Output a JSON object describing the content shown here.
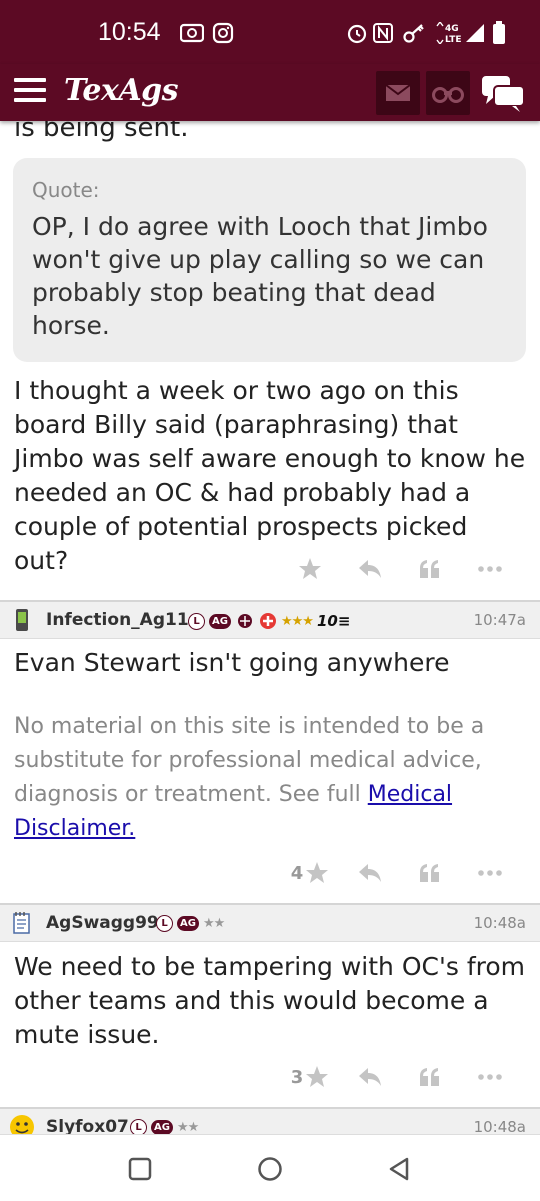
{
  "status_bar": {
    "time": "10:54",
    "network": "4G LTE"
  },
  "app_bar": {
    "logo": "TexAgs"
  },
  "thread": {
    "top_text": "is being sent.",
    "quote_label": "Quote:",
    "quote_text": "OP, I do agree with Looch that Jimbo won't give up play calling so we can probably stop beating that dead horse.",
    "reply_text": "I thought a week or two ago on this board Billy said (paraphrasing) that Jimbo was self aware enough to know he needed an OC & had probably had a couple of potential prospects picked out?"
  },
  "posts": [
    {
      "username": "Infection_Ag11",
      "badge_l": "L",
      "badge_ag": "AG",
      "stars": "★★★",
      "extra_badge": "10",
      "time": "10:47a",
      "text": "Evan Stewart isn't going anywhere",
      "disclaimer": "No material on this site is intended to be a substitute for professional medical advice, diagnosis or treatment. See full ",
      "disclaimer_link": "Medical Disclaimer.",
      "star_count": "4"
    },
    {
      "username": "AgSwagg99",
      "badge_l": "L",
      "badge_ag": "AG",
      "stars": "★★",
      "time": "10:48a",
      "text": "We need to be tampering with OC's from other teams and this would become a mute issue.",
      "star_count": "3"
    },
    {
      "username": "Slyfox07",
      "badge_l": "L",
      "badge_ag": "AG",
      "stars": "★★",
      "time": "10:48a"
    }
  ],
  "colors": {
    "maroon": "#5c0a24",
    "gold": "#d5a200"
  }
}
